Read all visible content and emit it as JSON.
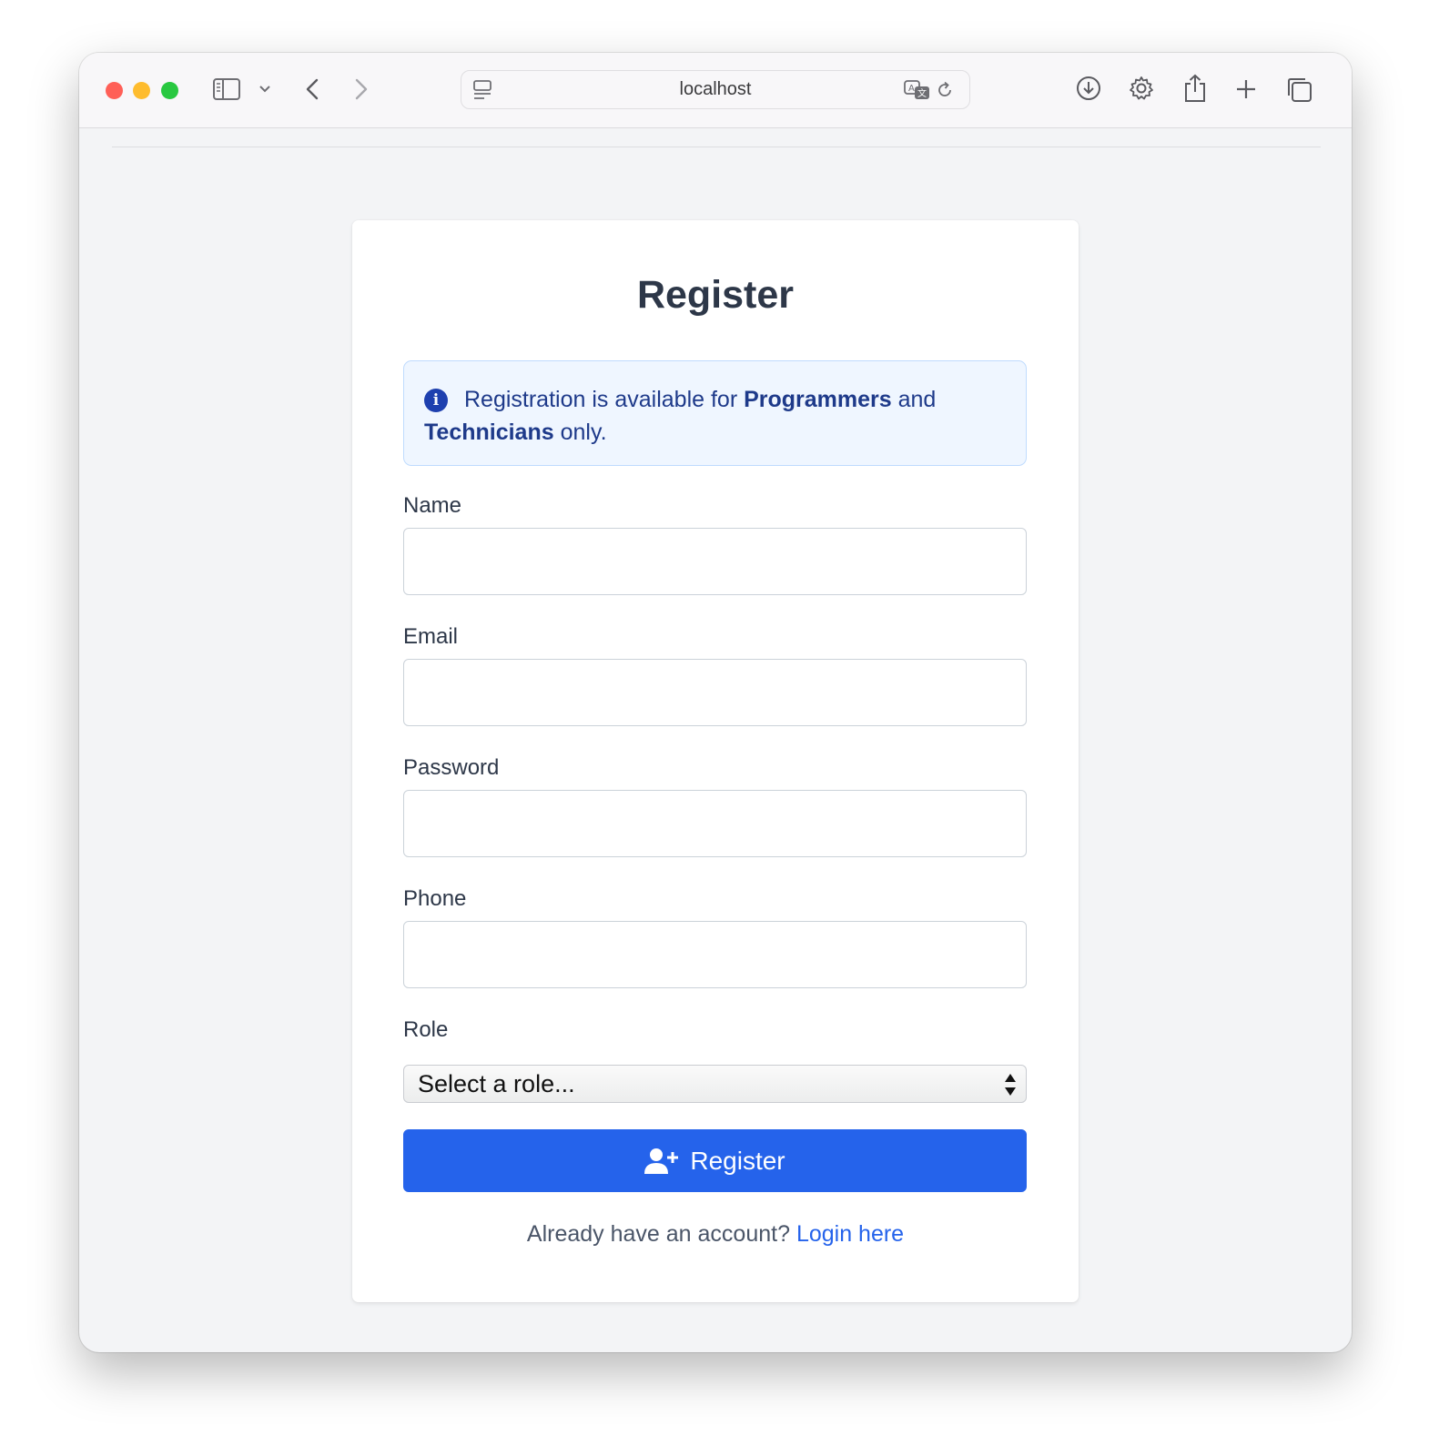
{
  "browser": {
    "address": "localhost",
    "traffic_lights": {
      "close": "#ff5f57",
      "minimize": "#febc2e",
      "zoom": "#28c840"
    },
    "toolbar_icons": [
      "sidebar-icon",
      "chevron-down-icon",
      "back-icon",
      "forward-icon",
      "page-menu-icon",
      "translate-icon",
      "reload-icon",
      "download-icon",
      "settings-gear-icon",
      "share-icon",
      "new-tab-plus-icon",
      "tab-overview-icon"
    ]
  },
  "form": {
    "title": "Register",
    "alert": {
      "icon": "info-circle-icon",
      "text_before": "Registration is available for ",
      "role_one": "Programmers",
      "text_middle": " and",
      "role_two": "Technicians",
      "text_after": " only."
    },
    "fields": {
      "name": {
        "label": "Name",
        "value": "",
        "placeholder": ""
      },
      "email": {
        "label": "Email",
        "value": "",
        "placeholder": ""
      },
      "password": {
        "label": "Password",
        "value": "",
        "placeholder": ""
      },
      "phone": {
        "label": "Phone",
        "value": "",
        "placeholder": ""
      },
      "role": {
        "label": "Role",
        "selected": "Select a role..."
      }
    },
    "submit": {
      "label": "Register",
      "icon": "user-plus-icon"
    },
    "footer": {
      "prompt": "Already have an account? ",
      "link_text": "Login here"
    }
  },
  "colors": {
    "primary": "#2563eb",
    "alert_bg": "#eff6ff",
    "alert_text": "#1e3a8a",
    "page_bg": "#f3f4f6"
  }
}
